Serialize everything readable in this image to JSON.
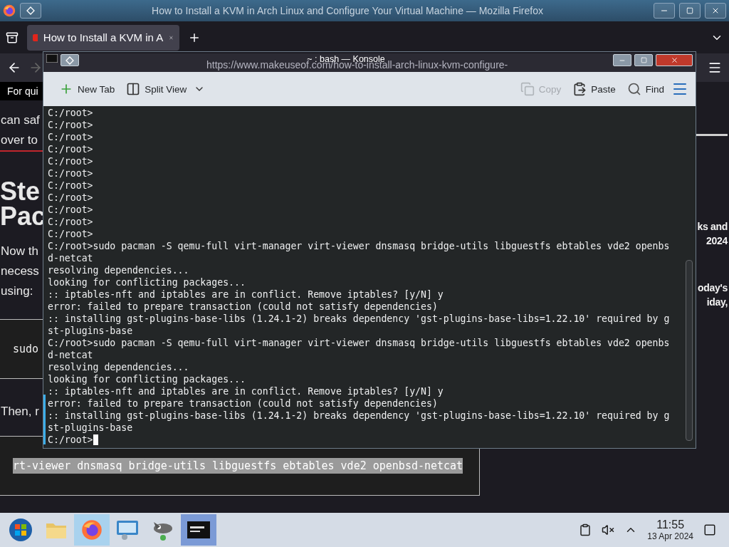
{
  "firefox": {
    "title": "How to Install a KVM in Arch Linux and Configure Your Virtual Machine — Mozilla Firefox",
    "tabs": [
      {
        "label": "How to Install a KVM in A",
        "selected": true
      }
    ],
    "url": "https://www.makeuseof.com/how-to-install-arch-linux-kvm-configure-",
    "article": {
      "notice": "For qui",
      "paragraph_1": [
        "can saf",
        "over to"
      ],
      "heading": [
        "Ste",
        "Pac"
      ],
      "paragraph_2": [
        "Now th",
        "necess",
        "using:"
      ],
      "code_1": "sudo",
      "paragraph_3": "Then, r",
      "code_2": "rt-viewer dnsmasq bridge-utils libguestfs ebtables vde2 openbsd-netcat"
    },
    "sidebar": {
      "block_1": [
        "ks and",
        "2024"
      ],
      "block_2": [
        "oday's",
        "iday,"
      ]
    }
  },
  "konsole": {
    "title": "~ : bash — Konsole",
    "toolbar": [
      {
        "kind": "new-tab",
        "label": "New Tab",
        "disabled": false
      },
      {
        "kind": "split",
        "label": "Split View",
        "disabled": false
      },
      {
        "kind": "copy",
        "label": "Copy",
        "disabled": true
      },
      {
        "kind": "paste",
        "label": "Paste",
        "disabled": false
      },
      {
        "kind": "find",
        "label": "Find",
        "disabled": false
      }
    ],
    "lines": [
      "C:/root>",
      "C:/root>",
      "C:/root>",
      "C:/root>",
      "C:/root>",
      "C:/root>",
      "C:/root>",
      "C:/root>",
      "C:/root>",
      "C:/root>",
      "C:/root>",
      "C:/root>sudo pacman -S qemu-full virt-manager virt-viewer dnsmasq bridge-utils libguestfs ebtables vde2 openbs",
      "d-netcat",
      "resolving dependencies...",
      "looking for conflicting packages...",
      ":: iptables-nft and iptables are in conflict. Remove iptables? [y/N] y",
      "error: failed to prepare transaction (could not satisfy dependencies)",
      ":: installing gst-plugins-base-libs (1.24.1-2) breaks dependency 'gst-plugins-base-libs=1.22.10' required by g",
      "st-plugins-base",
      "C:/root>sudo pacman -S qemu-full virt-manager virt-viewer dnsmasq bridge-utils libguestfs ebtables vde2 openbs",
      "d-netcat",
      "resolving dependencies...",
      "looking for conflicting packages...",
      ":: iptables-nft and iptables are in conflict. Remove iptables? [y/N] y",
      "error: failed to prepare transaction (could not satisfy dependencies)",
      ":: installing gst-plugins-base-libs (1.24.1-2) breaks dependency 'gst-plugins-base-libs=1.22.10' required by g",
      "st-plugins-base",
      "C:/root>"
    ]
  },
  "taskbar": {
    "apps": [
      {
        "kind": "start",
        "selected": false,
        "hovered": false
      },
      {
        "kind": "files",
        "selected": false,
        "hovered": false
      },
      {
        "kind": "browser",
        "selected": false,
        "hovered": true
      },
      {
        "kind": "remote",
        "selected": false,
        "hovered": false
      },
      {
        "kind": "gimp",
        "selected": false,
        "hovered": false
      },
      {
        "kind": "terminal",
        "selected": true,
        "hovered": false
      }
    ],
    "time": "11:55",
    "date": "13 Apr 2024"
  }
}
